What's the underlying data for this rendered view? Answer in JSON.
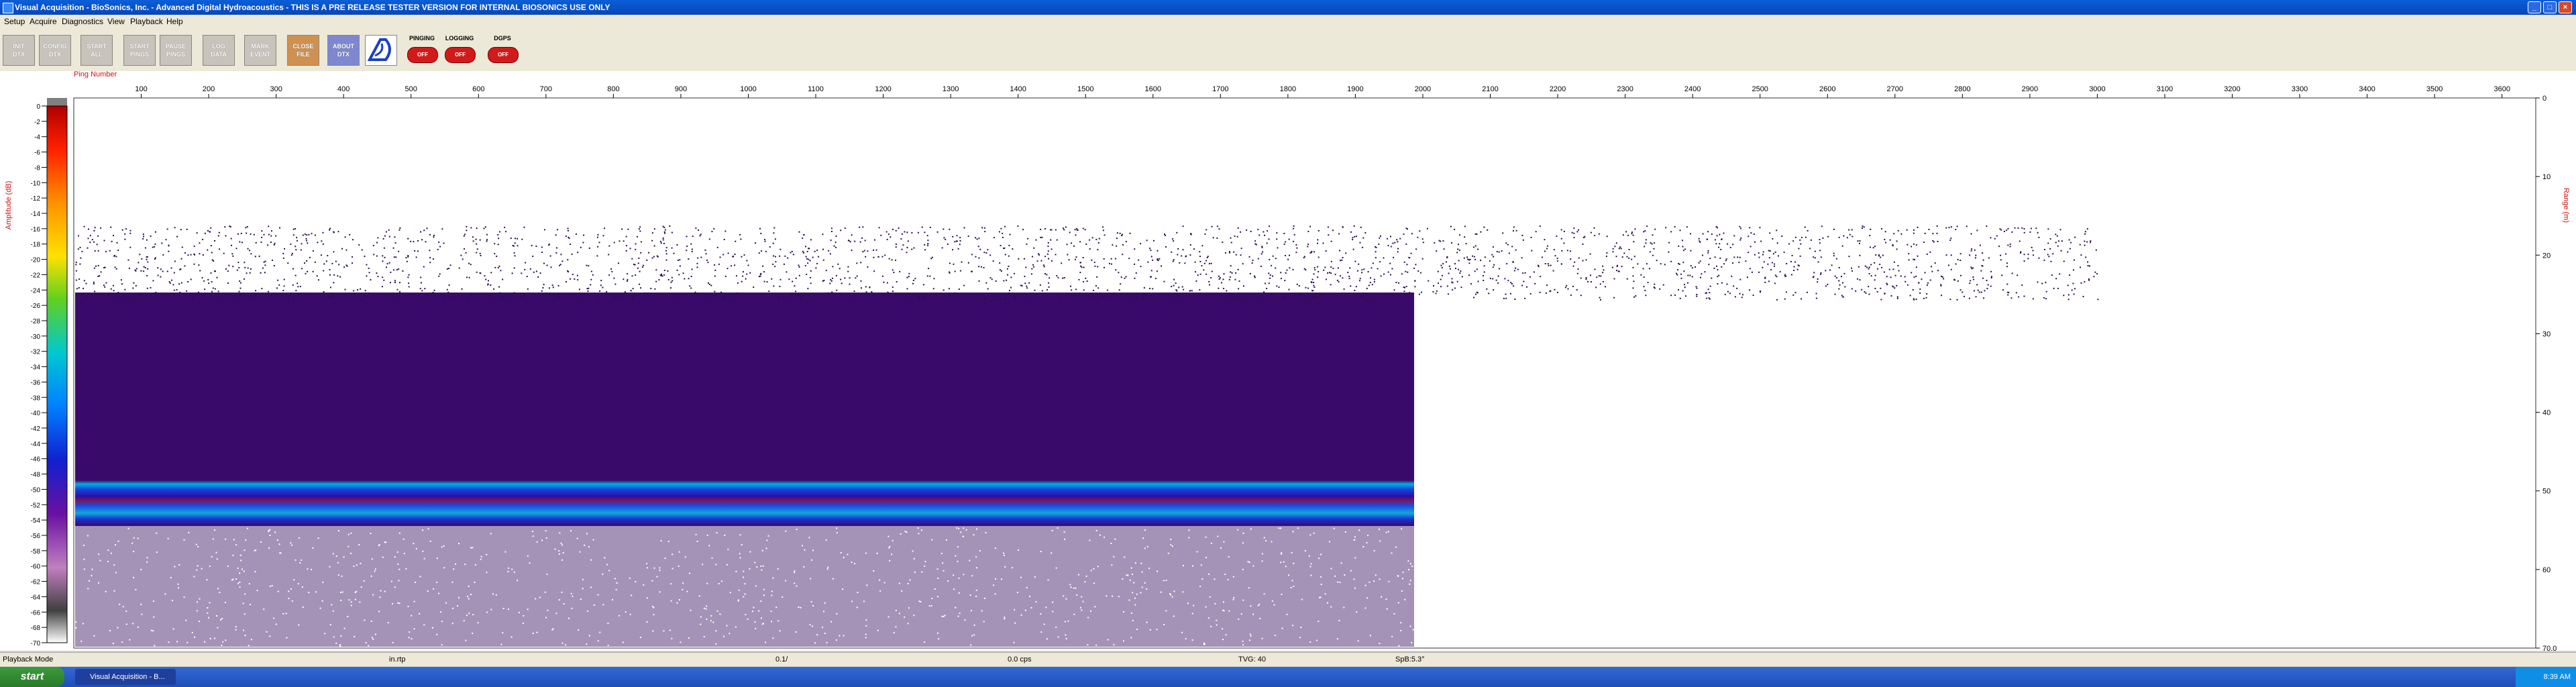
{
  "window": {
    "title": "Visual Acquisition  -  BioSonics, Inc.  -  Advanced Digital Hydroacoustics  -  THIS IS A PRE RELEASE TESTER VERSION FOR INTERNAL BIOSONICS USE ONLY"
  },
  "menu": [
    "Setup",
    "Acquire",
    "Diagnostics",
    "View",
    "Playback",
    "Help"
  ],
  "toolbar": {
    "buttons": [
      {
        "l1": "INIT",
        "l2": "DTX"
      },
      {
        "l1": "CONFIG",
        "l2": "DTX"
      },
      {
        "l1": "START",
        "l2": "ALL"
      },
      {
        "l1": "START",
        "l2": "PINGS"
      },
      {
        "l1": "PAUSE",
        "l2": "PINGS"
      },
      {
        "l1": "LOG",
        "l2": "DATA"
      },
      {
        "l1": "MARK",
        "l2": "EVENT"
      },
      {
        "l1": "CLOSE",
        "l2": "FILE"
      },
      {
        "l1": "ABOUT",
        "l2": "DTX"
      }
    ],
    "status": [
      {
        "label": "PINGING",
        "state": "OFF"
      },
      {
        "label": "LOGGING",
        "state": "OFF"
      },
      {
        "label": "DGPS",
        "state": "OFF"
      }
    ]
  },
  "plot": {
    "xlabel": "Ping Number",
    "left_axis_label": "Amplitude (dB)",
    "right_axis_label": "Range (m)",
    "x_ticks": [
      100,
      200,
      300,
      400,
      500,
      600,
      700,
      800,
      900,
      1000,
      1100,
      1200,
      1300,
      1400,
      1500,
      1600,
      1700,
      1800,
      1900,
      2000,
      2100,
      2200,
      2300,
      2400,
      2500,
      2600,
      2700,
      2800,
      2900,
      3000,
      3100,
      3200,
      3300,
      3400,
      3500,
      3600
    ],
    "x_max": 3650,
    "data_end_ping": 3000,
    "color_ticks": [
      0,
      -2,
      -4,
      -6,
      -8,
      -10,
      -12,
      -14,
      -16,
      -18,
      -20,
      -22,
      -24,
      -26,
      -28,
      -30,
      -32,
      -34,
      -36,
      -38,
      -40,
      -42,
      -44,
      -46,
      -48,
      -50,
      -52,
      -54,
      -56,
      -58,
      -60,
      -62,
      -64,
      -66,
      -68,
      -70
    ],
    "color_min": -70,
    "range_ticks": [
      "0",
      "10",
      "20",
      "30",
      "40",
      "50",
      "60",
      "70.0"
    ],
    "range_max": 70
  },
  "statusbar": {
    "fields": [
      "Playback Mode",
      "in.rtp",
      "0.1/",
      "0.0 cps",
      "TVG: 40",
      "SpB:5.3°"
    ]
  },
  "taskbar": {
    "start_label": "start",
    "task_label": "Visual Acquisition - B...",
    "clock": "8:39 AM"
  },
  "colors": {
    "titlebar": "#0a5fd8",
    "band": "#1e50e0",
    "noise": "#3a0a6a"
  }
}
